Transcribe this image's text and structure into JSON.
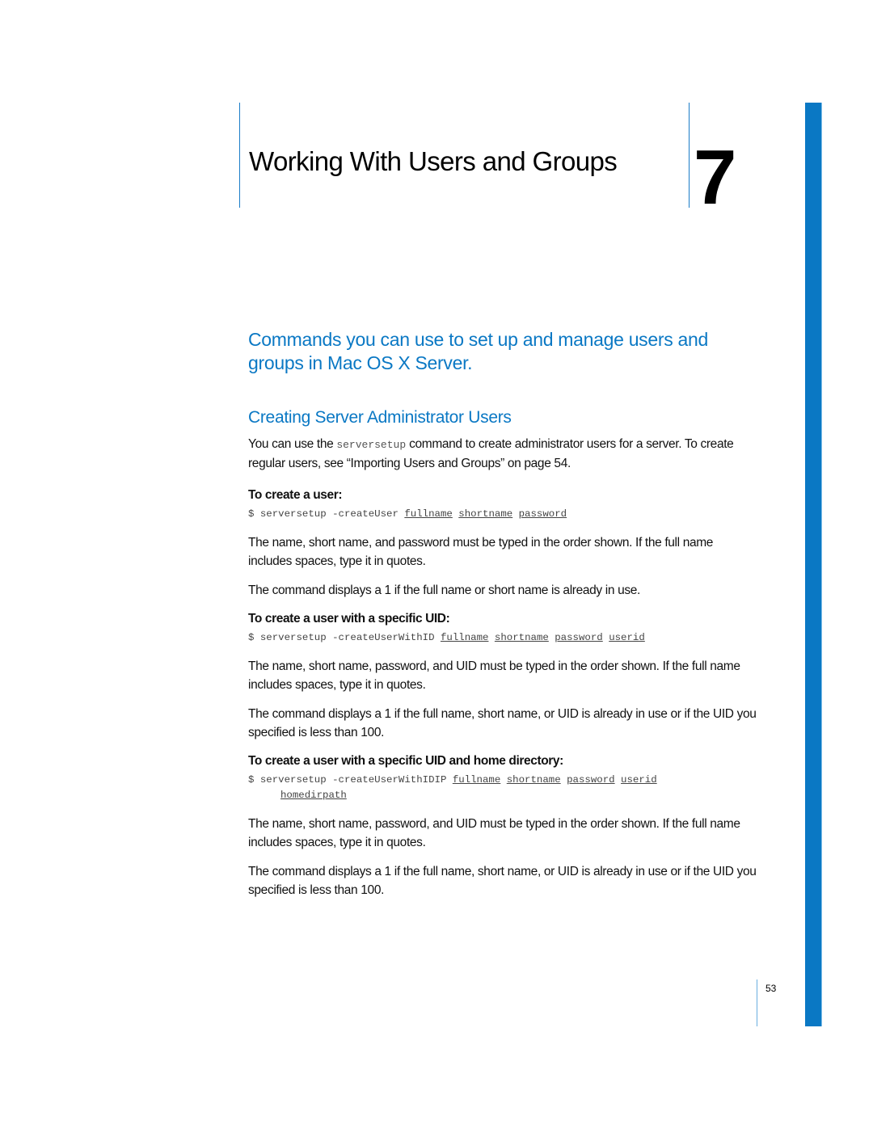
{
  "chapter": {
    "title": "Working With Users and Groups",
    "number": "7"
  },
  "intro": "Commands you can use to set up and manage users and groups in Mac OS X Server.",
  "section": {
    "heading": "Creating Server Administrator Users",
    "intro_before_code": "You can use the ",
    "intro_code": "serversetup",
    "intro_after_code": " command to create administrator users for a server. To create regular users, see “Importing Users and Groups” on page 54."
  },
  "tasks": [
    {
      "heading": "To create a user:",
      "command": {
        "prefix": "$ serversetup -createUser",
        "args": [
          "fullname",
          "shortname",
          "password"
        ],
        "continuation": ""
      },
      "paragraphs": [
        "The name, short name, and password must be typed in the order shown. If the full name includes spaces, type it in quotes.",
        "The command displays a 1 if the full name or short name is already in use."
      ]
    },
    {
      "heading": "To create a user with a specific UID:",
      "command": {
        "prefix": "$ serversetup -createUserWithID",
        "args": [
          "fullname",
          "shortname",
          "password",
          "userid"
        ],
        "continuation": ""
      },
      "paragraphs": [
        "The name, short name, password, and UID must be typed in the order shown. If the full name includes spaces, type it in quotes.",
        "The command displays a 1 if the full name, short name, or UID is already in use or if the UID you specified is less than 100."
      ]
    },
    {
      "heading": "To create a user with a specific UID and home directory:",
      "command": {
        "prefix": "$ serversetup -createUserWithIDIP",
        "args": [
          "fullname",
          "shortname",
          "password",
          "userid"
        ],
        "continuation": "homedirpath"
      },
      "paragraphs": [
        "The name, short name, password, and UID must be typed in the order shown. If the full name includes spaces, type it in quotes.",
        "The command displays a 1 if the full name, short name, or UID is already in use or if the UID you specified is less than 100."
      ]
    }
  ],
  "page_number": "53",
  "colors": {
    "accent_blue": "#0a78c4",
    "rule_blue": "#1a7cc8"
  }
}
